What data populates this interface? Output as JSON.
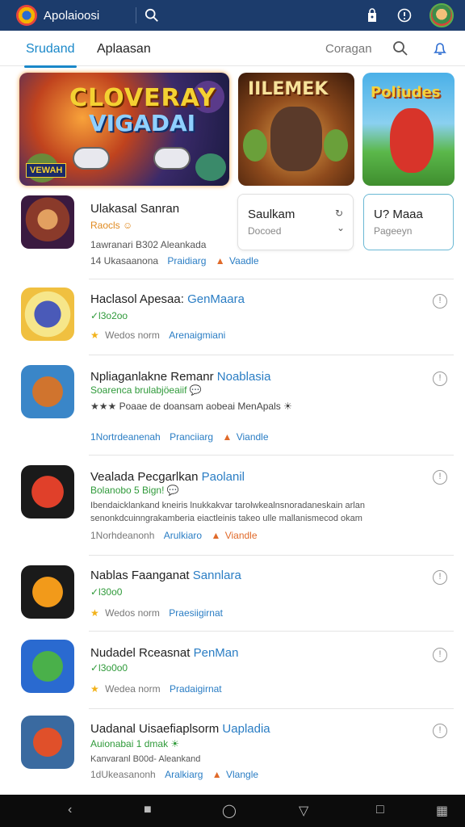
{
  "app_bar": {
    "title": "Apolaioosi",
    "icons": [
      "app-logo-icon",
      "search-icon",
      "shopping-bag-icon",
      "info-icon",
      "avatar"
    ]
  },
  "tabs": {
    "items": [
      "Srudand",
      "Aplaasan",
      "Coragan"
    ],
    "active_index": 0
  },
  "banners": [
    {
      "title_line1": "CLOVERAY",
      "title_line2": "VIGADAI",
      "tag": "VEWAH"
    },
    {
      "title_line1": "IILEMEK"
    },
    {
      "title_line1": "Poliudes"
    }
  ],
  "featured_app": {
    "title": "Ulakasal Sanran",
    "subtitle": "Raocls ☺",
    "meta1": "1awranari B302 Aleankada",
    "meta2_left": "14 Ukasaanona",
    "meta2_mid": "Praidiarg",
    "meta2_right": "Vaadle"
  },
  "mini_cards": [
    {
      "title": "Saulkam",
      "subtitle": "Docoed"
    },
    {
      "title": "U? Maaa",
      "subtitle": "Pageeyn"
    }
  ],
  "apps": [
    {
      "title": "Haclasol Apesaa:",
      "accent": "GenMaara",
      "sub": "✓l3o2oo",
      "meta_left": "Wedos norm",
      "meta_mid": "Arenaigmiani",
      "meta_right": ""
    },
    {
      "title": "Npliaganlakne Remanr",
      "accent": "Noablasia",
      "sub": "Soarenca brulabjöeaiif 💬",
      "desc": "★★★ Poaae de doansam aobeai MenApals ☀",
      "meta_left": "1Nortrdeanenah",
      "meta_mid": "Pranciiarg",
      "meta_right": "Viandle"
    },
    {
      "title": "Vealada Pecgarlkan",
      "accent": "Paolanil",
      "sub": "Bolanobo 5 Bign! 💬",
      "desc": "Ibendaicklankand kneiris lnukkakvar tarolwkealnsnoradaneskain arlan",
      "desc2": "senonkdcuinngrakamberia eiactleinis takeo ulle mallanismecod okam",
      "meta_left": "1Norhdeanonh",
      "meta_mid": "Arulkiaro",
      "meta_right": "Viandle"
    },
    {
      "title": "Nablas Faanganat",
      "accent": "Sannlara",
      "sub": "✓l30o0",
      "meta_left": "Wedos norm",
      "meta_mid": "Praesiigirnat",
      "meta_right": ""
    },
    {
      "title": "Nudadel Rceasnat",
      "accent": "PenMan",
      "sub": "✓l3o0o0",
      "meta_left": "Wedea norm",
      "meta_mid": "Pradaigirnat",
      "meta_right": ""
    },
    {
      "title": "Uadanal Uisaefiaplsorm",
      "accent": "Uapladia",
      "sub": "Auionabai 1 dmak ☀",
      "desc": "Kanvaranl B00d- Aleankand",
      "meta_left": "1dUkeasanonh",
      "meta_mid": "Aralkiarg",
      "meta_right": "Vlangle"
    }
  ],
  "nav": {
    "icons": [
      "back-icon",
      "square-icon",
      "home-circle-icon",
      "down-triangle-icon",
      "recents-icon",
      "grid-icon"
    ]
  }
}
